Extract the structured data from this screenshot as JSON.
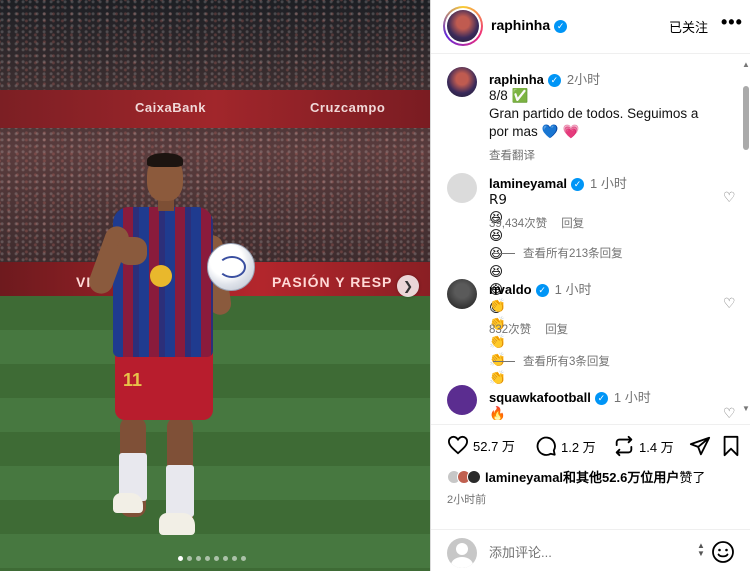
{
  "post": {
    "username": "raphinha",
    "follow_status": "已关注",
    "more_label": "•••"
  },
  "caption": {
    "username": "raphinha",
    "time": "2小时",
    "line1": "8/8",
    "line1_emoji": "✅",
    "line2": "Gran partido de todos. Seguimos a",
    "line3": "por mas",
    "line3_emoji": "💙 💗",
    "translate": "查看翻译"
  },
  "comments": [
    {
      "username": "lamineyamal",
      "time": "1 小时",
      "text": "R9😆😆😆😆😆😆",
      "likes": "39,434次赞",
      "reply": "回复",
      "view_replies": "查看所有213条回复"
    },
    {
      "username": "rivaldo",
      "time": "1 小时",
      "text": "👏👏👏👏👏",
      "likes": "832次赞",
      "reply": "回复",
      "view_replies": "查看所有3条回复"
    },
    {
      "username": "squawkafootball",
      "time": "1 小时",
      "text": "🔥🔥🔥🔥🔥"
    }
  ],
  "actions": {
    "likes_count": "52.7 万",
    "comments_count": "1.2 万",
    "reposts_count": "1.4 万"
  },
  "liked_by": {
    "user": "lamineyamal",
    "rest": "和其他52.6万位用户",
    "suffix": "赞了"
  },
  "posted_time": "2小时前",
  "add_comment": {
    "placeholder": "添加评论..."
  },
  "photo": {
    "banner_top_1": "CaixaBank",
    "banner_top_2": "Cruzcampo",
    "banner_bottom": "PASIÓN Y RESP",
    "banner_bottom_left": "VI",
    "jersey_number": "11",
    "carousel_total": 8,
    "carousel_active": 1
  },
  "colors": {
    "verified_blue": "#0095f6",
    "secondary_text": "#737373"
  }
}
